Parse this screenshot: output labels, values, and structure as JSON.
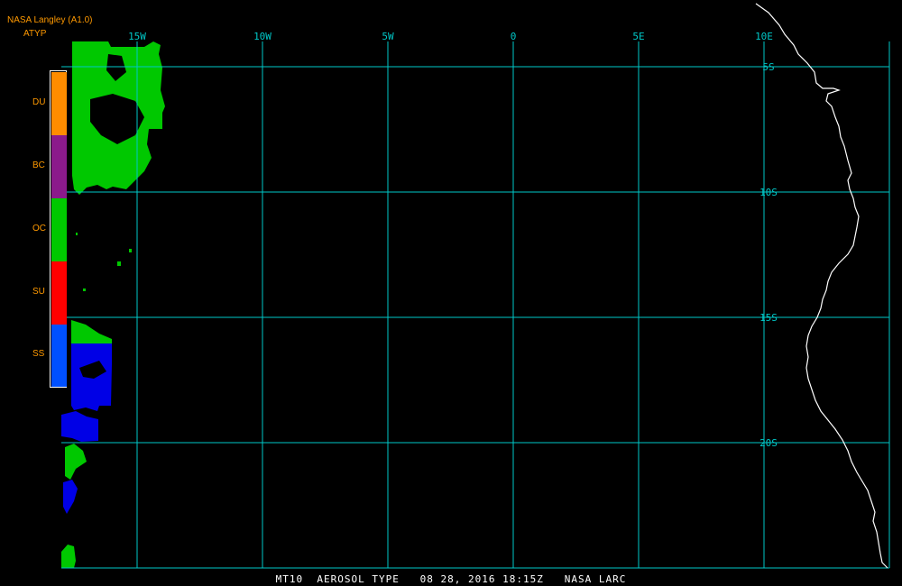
{
  "header": {
    "source": "NASA Langley (A1.0)",
    "product": "ATYP"
  },
  "legend": [
    {
      "label": "DU",
      "color": "#ff8c00"
    },
    {
      "label": "BC",
      "color": "#8b1a8b"
    },
    {
      "label": "OC",
      "color": "#00c800"
    },
    {
      "label": "SU",
      "color": "#ff0000"
    },
    {
      "label": "SS",
      "color": "#0050ff"
    }
  ],
  "map": {
    "grid_color": "#00c8c8",
    "coast_color": "#ffffff",
    "longitudes": [
      {
        "label": "15W",
        "lon": -15
      },
      {
        "label": "10W",
        "lon": -10
      },
      {
        "label": "5W",
        "lon": -5
      },
      {
        "label": "0",
        "lon": 0
      },
      {
        "label": "5E",
        "lon": 5
      },
      {
        "label": "10E",
        "lon": 10
      }
    ],
    "latitudes": [
      {
        "label": "5S",
        "lat": -5
      },
      {
        "label": "10S",
        "lat": -10
      },
      {
        "label": "15S",
        "lat": -15
      },
      {
        "label": "20S",
        "lat": -20
      }
    ]
  },
  "footer": "MT10  AEROSOL TYPE   08 28, 2016 18:15Z   NASA LARC"
}
